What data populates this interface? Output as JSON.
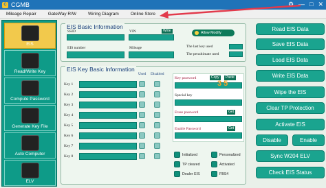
{
  "window": {
    "logo": "C",
    "title": "CGMB",
    "controls": [
      "⚙",
      "—",
      "□",
      "✕"
    ]
  },
  "menu": [
    "Mileage Repair",
    "GateWay R/W",
    "Wiring Diagram",
    "Online Store"
  ],
  "sidebar": [
    {
      "label": "EIS",
      "icon": "eis-key-icon",
      "active": true
    },
    {
      "label": "Read/Write Key",
      "icon": "car-key-icon",
      "active": false
    },
    {
      "label": "Compute Password",
      "icon": "ecu-icon",
      "active": false
    },
    {
      "label": "Generate Key File",
      "icon": "key-fob-icon",
      "active": false
    },
    {
      "label": "Auto Computer",
      "icon": "auto-computer-icon",
      "active": false
    },
    {
      "label": "ELV",
      "icon": "elv-module-icon",
      "active": false
    }
  ],
  "basic": {
    "title": "EIS Basic Information",
    "ssid": "SSID",
    "vin": "VIN",
    "write": "Write",
    "allow_modify": "Allow Modify",
    "eis_number": "EIS number",
    "mileage": "Mileage",
    "last_key": "The last key used",
    "penultimate": "The penultimate used"
  },
  "keys": {
    "title": "EIS Key Basic Information",
    "used": "Used",
    "disabled": "Disabled",
    "labels": [
      "Key 1",
      "Key 2",
      "Key 3",
      "Key 4",
      "Key 5",
      "Key 6",
      "Key 7",
      "Key 8"
    ],
    "key_password": "Key password",
    "copy": "Copy",
    "paste": "Paste",
    "special_key": "Special key",
    "erase_password": "Erase password",
    "get": "Get",
    "enable_password": "Enable Password",
    "legend": [
      "Initialized",
      "Personalized",
      "TP cleared",
      "Activated",
      "Dealer EIS",
      "FBS4"
    ]
  },
  "actions": [
    "Read  EIS Data",
    "Save EIS Data",
    "Load EIS Data",
    "Write EIS Data",
    "Wipe the EIS",
    "Clear TP Protection",
    "Activate EIS",
    "Disable",
    "Enable",
    "Sync W204 ELV",
    "Check EIS Status"
  ],
  "watermark": "3 5",
  "colors": {
    "accent": "#1aa48f",
    "sidebar": "#0e9b88",
    "active": "#f2c94c",
    "title": "#1f73b8",
    "arrow": "#e23a4c"
  }
}
